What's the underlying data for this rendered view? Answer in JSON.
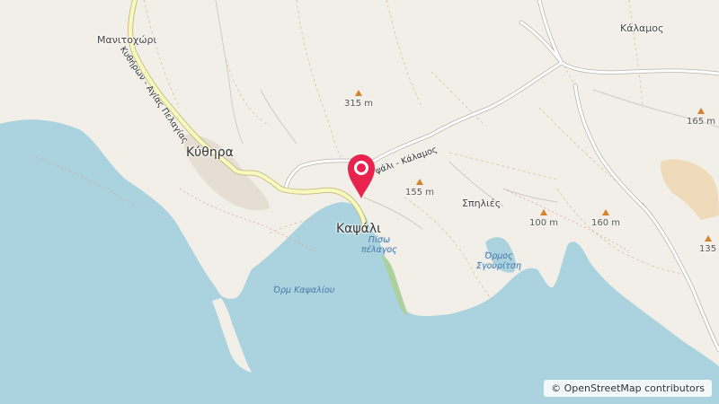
{
  "map": {
    "places": {
      "manitochori": "Μανιτοχώρι",
      "kalamos": "Κάλαμος",
      "kythira": "Κύθηρα",
      "kapsali": "Καψάλι",
      "spilies": "Σπηλιές"
    },
    "peaks": {
      "p315": "315 m",
      "p165": "165 m",
      "p155": "155 m",
      "p100": "100 m",
      "p160": "160 m",
      "p135": "135"
    },
    "water": {
      "bay_kapsali": "Όρμ Καψαλίου",
      "piso_pelagos_1": "Πίσω",
      "piso_pelagos_2": "πέλαγος",
      "bay_sgouritsi_1": "Όρμος",
      "bay_sgouritsi_2": "Σγουρίτση"
    },
    "roads": {
      "road_north": "Κυθήρων - Αγίας Πελαγίας",
      "road_east": "ψάλι - Κάλαμος"
    },
    "colors": {
      "land": "#f2efe9",
      "sea": "#aad3df",
      "road_fill": "#ffffff",
      "primary_road": "#f7fabf",
      "marker": "#e8244e",
      "peak": "#d4822e"
    },
    "icons": {
      "marker": "location-pin-icon",
      "peak": "peak-triangle-icon"
    },
    "attribution": "© OpenStreetMap contributors"
  }
}
